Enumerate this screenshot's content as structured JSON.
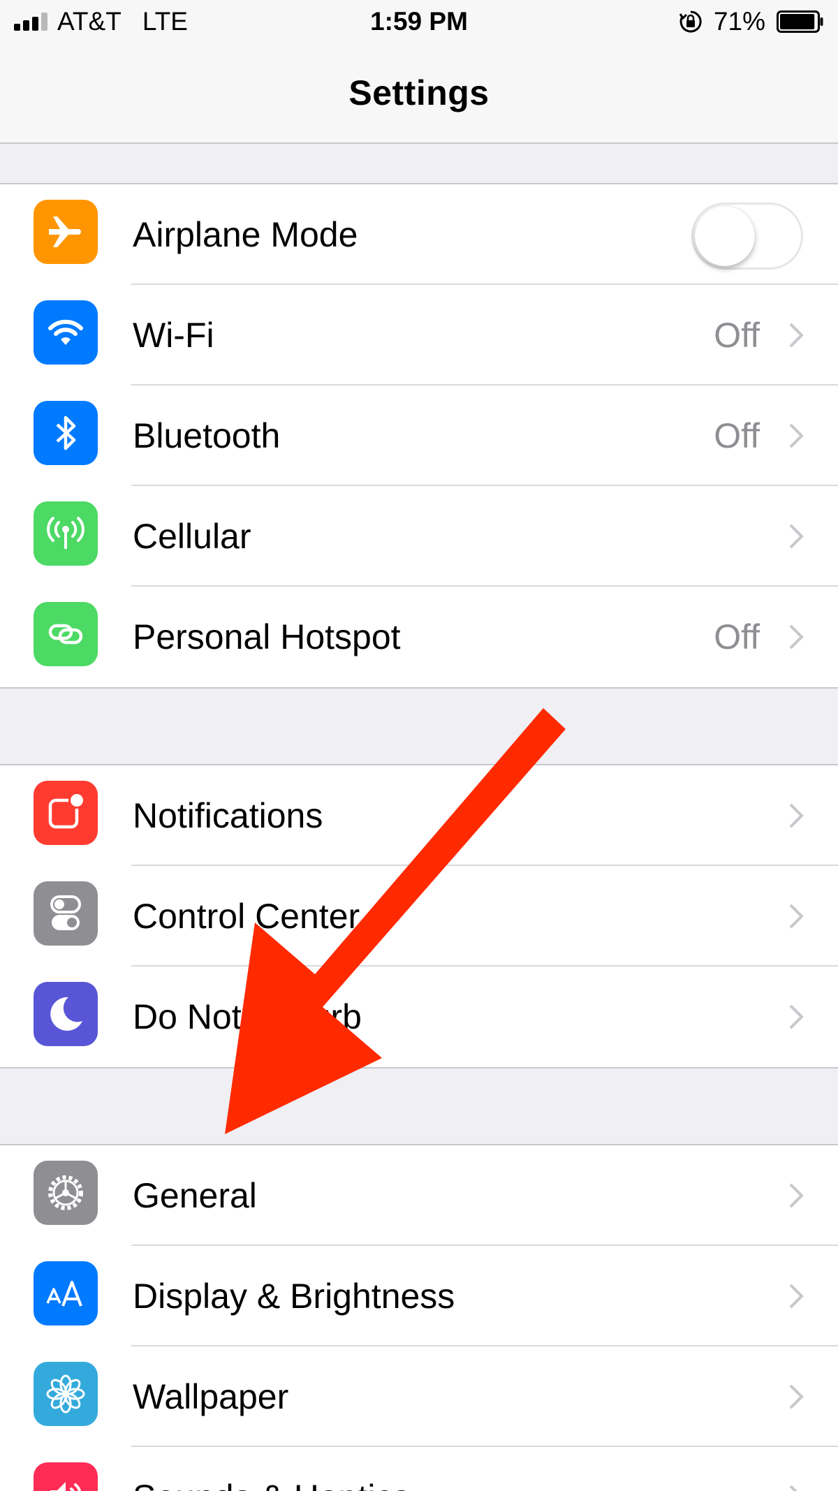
{
  "status_bar": {
    "carrier": "AT&T",
    "network": "LTE",
    "time": "1:59 PM",
    "battery_percent": "71%",
    "battery_level": 0.71,
    "signal_bars_filled": 3,
    "signal_bars_total": 4
  },
  "nav": {
    "title": "Settings"
  },
  "groups": [
    {
      "rows": [
        {
          "label": "Airplane Mode",
          "icon": "airplane-icon",
          "icon_color": "#ff9500",
          "control": "toggle",
          "toggle_on": false
        },
        {
          "label": "Wi-Fi",
          "icon": "wifi-icon",
          "icon_color": "#007aff",
          "value": "Off"
        },
        {
          "label": "Bluetooth",
          "icon": "bluetooth-icon",
          "icon_color": "#007aff",
          "value": "Off"
        },
        {
          "label": "Cellular",
          "icon": "cellular-antenna-icon",
          "icon_color": "#4cd964"
        },
        {
          "label": "Personal Hotspot",
          "icon": "hotspot-link-icon",
          "icon_color": "#4cd964",
          "value": "Off"
        }
      ]
    },
    {
      "rows": [
        {
          "label": "Notifications",
          "icon": "notifications-icon",
          "icon_color": "#ff3b30"
        },
        {
          "label": "Control Center",
          "icon": "control-center-icon",
          "icon_color": "#8e8e93"
        },
        {
          "label": "Do Not Disturb",
          "icon": "moon-icon",
          "icon_color": "#5856d6"
        }
      ]
    },
    {
      "rows": [
        {
          "label": "General",
          "icon": "gear-icon",
          "icon_color": "#8e8e93"
        },
        {
          "label": "Display & Brightness",
          "icon": "text-size-icon",
          "icon_color": "#007aff"
        },
        {
          "label": "Wallpaper",
          "icon": "flower-icon",
          "icon_color": "#34aadc"
        },
        {
          "label": "Sounds & Haptics",
          "icon": "speaker-icon",
          "icon_color": "#ff2d55"
        }
      ]
    }
  ],
  "annotation": {
    "arrow_color": "#ff2a00"
  }
}
